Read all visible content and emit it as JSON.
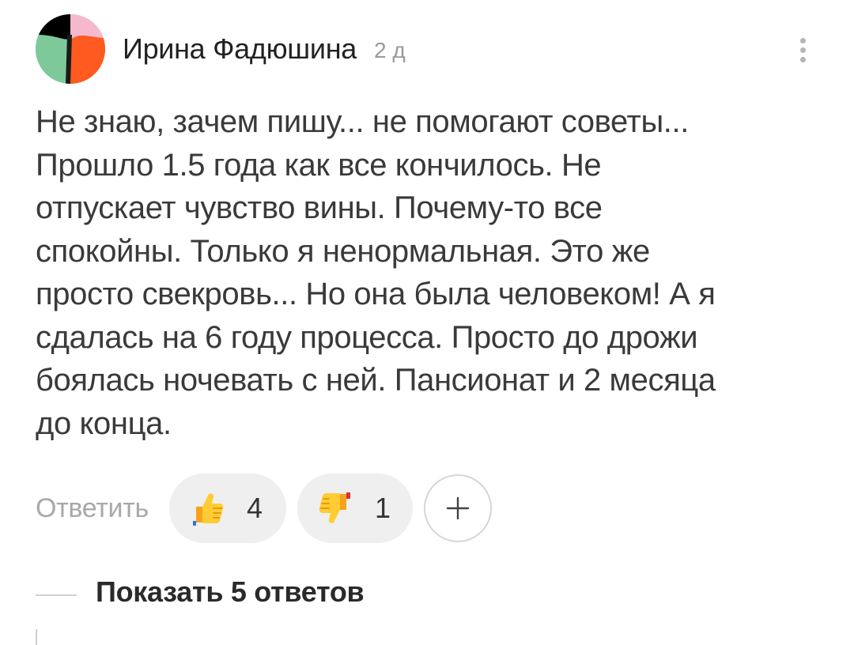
{
  "comment": {
    "author": {
      "name": "Ирина Фадюшина",
      "avatar_colors": [
        "#000000",
        "#f5b8cc",
        "#7ec99a",
        "#ff5a1f"
      ]
    },
    "timestamp": "2 д",
    "more_icon": "more-vertical-icon",
    "text_lines": [
      "Не знаю, зачем пишу... не помогают советы...",
      "Прошло 1.5 года как все кончилось. Не",
      "отпускает чувство вины. Почему-то все",
      "спокойны. Только я ненормальная. Это же",
      "просто свекровь... Но она была человеком! А я",
      "сдалась на 6 году процесса. Просто до дрожи",
      "боялась ночевать с ней. Пансионат и 2 месяца",
      "до конца."
    ],
    "actions": {
      "reply_label": "Ответить",
      "reactions": [
        {
          "icon": "thumbs-up-icon",
          "count": "4"
        },
        {
          "icon": "thumbs-down-icon",
          "count": "1"
        }
      ],
      "add_reaction_icon": "plus-icon"
    },
    "replies": {
      "show_label": "Показать 5 ответов"
    }
  }
}
